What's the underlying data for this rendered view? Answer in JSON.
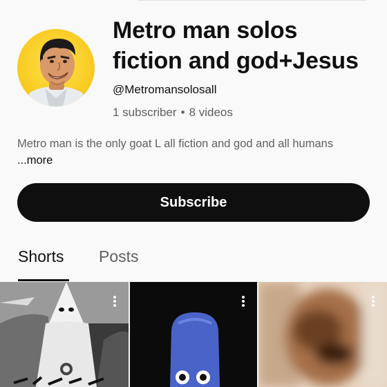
{
  "channel": {
    "name_line1": "Metro man solos",
    "name_line2": "fiction and god+Jesus",
    "handle": "@Metromansolosall",
    "subscribers": "1 subscriber",
    "separator": "•",
    "videos": "8 videos",
    "description": "Metro man is the only goat L all fiction and god and all humans",
    "more_label": "...more",
    "avatar_bg": "#f8c820"
  },
  "actions": {
    "subscribe_label": "Subscribe"
  },
  "tabs": [
    {
      "label": "Shorts",
      "selected": true
    },
    {
      "label": "Posts",
      "selected": false
    }
  ],
  "shorts": [
    {
      "thumbnail": "black-and-white-hooded-figure-image",
      "menu_icon": "more-vert-icon"
    },
    {
      "thumbnail": "blue-big-head-character-image",
      "menu_icon": "more-vert-icon"
    },
    {
      "thumbnail": "blurry-face-closeup-image",
      "menu_icon": "more-vert-icon"
    }
  ],
  "colors": {
    "background": "#f9f9f9",
    "text_primary": "#0f0f0f",
    "text_secondary": "#606060",
    "button_bg": "#0f0f0f",
    "button_text": "#ffffff"
  }
}
